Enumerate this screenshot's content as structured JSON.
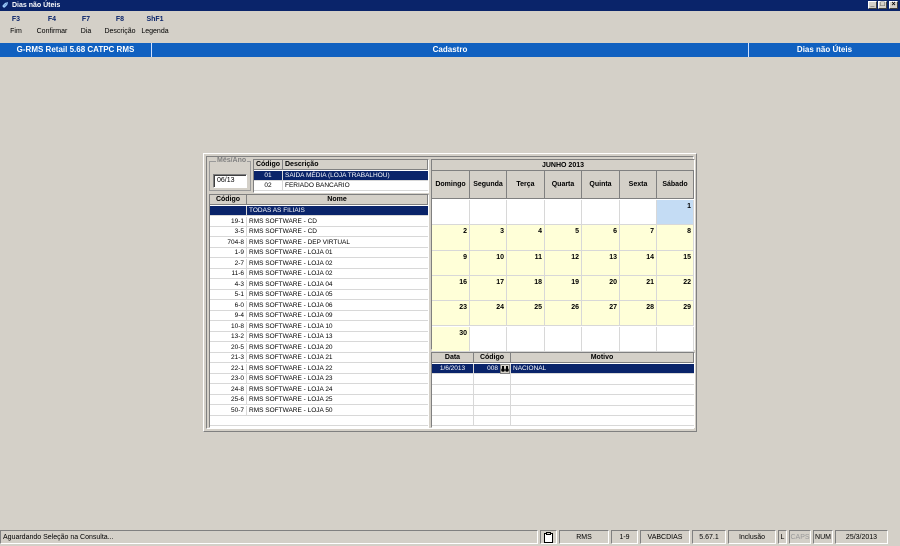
{
  "window": {
    "title": "Dias não Úteis",
    "min": "_",
    "max": "□",
    "close": "×"
  },
  "fkeys": [
    {
      "key": "F3",
      "label": "Fim"
    },
    {
      "key": "F4",
      "label": "Confirmar"
    },
    {
      "key": "F7",
      "label": "Dia"
    },
    {
      "key": "F8",
      "label": "Descrição"
    },
    {
      "key": "ShF1",
      "label": "Legenda"
    }
  ],
  "header": {
    "app": "G-RMS Retail 5.68 CATPC RMS",
    "section": "Cadastro",
    "screen": "Dias não Úteis"
  },
  "mesano": {
    "label": "Mês/Ano",
    "value": "06/13"
  },
  "tipos": {
    "headers": {
      "codigo": "Código",
      "descricao": "Descrição"
    },
    "rows": [
      {
        "codigo": "01",
        "descricao": "SAIDA MÉDIA (LOJA TRABALHOU)"
      },
      {
        "codigo": "02",
        "descricao": "FERIADO BANCARIO"
      }
    ]
  },
  "filiais": {
    "headers": {
      "codigo": "Código",
      "nome": "Nome"
    },
    "rows": [
      {
        "codigo": "",
        "nome": "TODAS AS FILIAIS"
      },
      {
        "codigo": "19-1",
        "nome": "RMS SOFTWARE  -  CD"
      },
      {
        "codigo": "3-5",
        "nome": "RMS SOFTWARE - CD"
      },
      {
        "codigo": "704-8",
        "nome": "RMS SOFTWARE - DEP VIRTUAL"
      },
      {
        "codigo": "1-9",
        "nome": "RMS SOFTWARE - LOJA 01"
      },
      {
        "codigo": "2-7",
        "nome": "RMS SOFTWARE - LOJA 02"
      },
      {
        "codigo": "11-6",
        "nome": "RMS SOFTWARE - LOJA 02"
      },
      {
        "codigo": "4-3",
        "nome": "RMS SOFTWARE - LOJA 04"
      },
      {
        "codigo": "5-1",
        "nome": "RMS SOFTWARE - LOJA 05"
      },
      {
        "codigo": "6-0",
        "nome": "RMS SOFTWARE - LOJA 06"
      },
      {
        "codigo": "9-4",
        "nome": "RMS SOFTWARE - LOJA 09"
      },
      {
        "codigo": "10-8",
        "nome": "RMS SOFTWARE - LOJA 10"
      },
      {
        "codigo": "13-2",
        "nome": "RMS SOFTWARE - LOJA 13"
      },
      {
        "codigo": "20-5",
        "nome": "RMS SOFTWARE - LOJA 20"
      },
      {
        "codigo": "21-3",
        "nome": "RMS SOFTWARE - LOJA 21"
      },
      {
        "codigo": "22-1",
        "nome": "RMS SOFTWARE - LOJA 22"
      },
      {
        "codigo": "23-0",
        "nome": "RMS SOFTWARE - LOJA 23"
      },
      {
        "codigo": "24-8",
        "nome": "RMS SOFTWARE - LOJA 24"
      },
      {
        "codigo": "25-6",
        "nome": "RMS SOFTWARE - LOJA 25"
      },
      {
        "codigo": "50-7",
        "nome": "RMS SOFTWARE - LOJA 50"
      }
    ]
  },
  "calendar": {
    "title": "JUNHO 2013",
    "days": [
      "Domingo",
      "Segunda",
      "Terça",
      "Quarta",
      "Quinta",
      "Sexta",
      "Sábado"
    ],
    "weeks": [
      [
        "",
        "",
        "",
        "",
        "",
        "",
        "1"
      ],
      [
        "2",
        "3",
        "4",
        "5",
        "6",
        "7",
        "8"
      ],
      [
        "9",
        "10",
        "11",
        "12",
        "13",
        "14",
        "15"
      ],
      [
        "16",
        "17",
        "18",
        "19",
        "20",
        "21",
        "22"
      ],
      [
        "23",
        "24",
        "25",
        "26",
        "27",
        "28",
        "29"
      ],
      [
        "30",
        "",
        "",
        "",
        "",
        "",
        ""
      ]
    ],
    "colors": {
      "filled": "#ffffd8",
      "selected": "#c4dcf4",
      "empty": "#ffffff"
    }
  },
  "motivos": {
    "headers": {
      "data": "Data",
      "codigo": "Código",
      "motivo": "Motivo"
    },
    "rows": [
      {
        "data": "1/6/2013",
        "codigo": "008",
        "motivo": "NACIONAL"
      }
    ]
  },
  "status": {
    "message": "Aguardando Seleção na Consulta...",
    "user": "RMS",
    "filial": "1-9",
    "program": "VABCDIAS",
    "version": "5.67.1",
    "mode": "Inclusão",
    "l": "L",
    "caps": "CAPS",
    "num": "NUM",
    "date": "25/3/2013"
  }
}
